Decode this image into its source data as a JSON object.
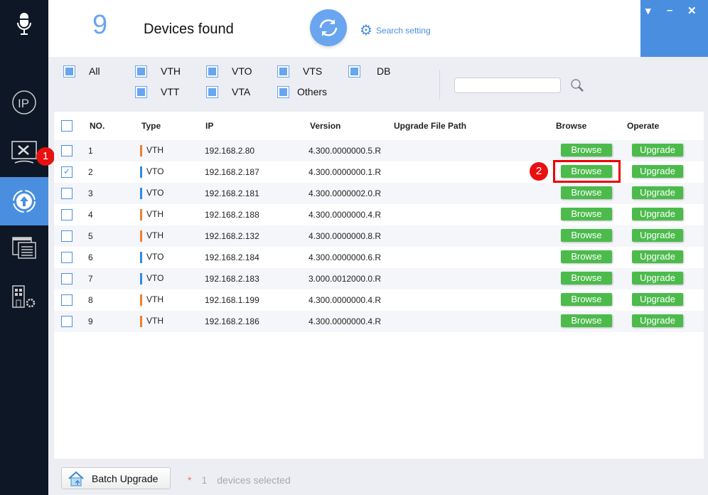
{
  "header": {
    "count": "9",
    "title": "Devices found",
    "search_setting": "Search setting"
  },
  "window": {
    "menu": "▾",
    "minimize": "–",
    "close": "✕"
  },
  "filters": [
    {
      "label": "All"
    },
    {
      "label": "VTH"
    },
    {
      "label": "VTO"
    },
    {
      "label": "VTS"
    },
    {
      "label": "DB"
    },
    {
      "label": "VTT"
    },
    {
      "label": "VTA"
    },
    {
      "label": "Others"
    }
  ],
  "search": {
    "value": "",
    "placeholder": ""
  },
  "table": {
    "columns": [
      "NO.",
      "Type",
      "IP",
      "Version",
      "Upgrade File Path",
      "Browse",
      "Operate"
    ],
    "browse_label": "Browse",
    "upgrade_label": "Upgrade",
    "rows": [
      {
        "no": "1",
        "type": "VTH",
        "ip": "192.168.2.80",
        "version": "4.300.0000000.5.R",
        "path": "",
        "checked": false
      },
      {
        "no": "2",
        "type": "VTO",
        "ip": "192.168.2.187",
        "version": "4.300.0000000.1.R",
        "path": "",
        "checked": true
      },
      {
        "no": "3",
        "type": "VTO",
        "ip": "192.168.2.181",
        "version": "4.300.0000002.0.R",
        "path": "",
        "checked": false
      },
      {
        "no": "4",
        "type": "VTH",
        "ip": "192.168.2.188",
        "version": "4.300.0000000.4.R",
        "path": "",
        "checked": false
      },
      {
        "no": "5",
        "type": "VTH",
        "ip": "192.168.2.132",
        "version": "4.300.0000000.8.R",
        "path": "",
        "checked": false
      },
      {
        "no": "6",
        "type": "VTO",
        "ip": "192.168.2.184",
        "version": "4.300.0000000.6.R",
        "path": "",
        "checked": false
      },
      {
        "no": "7",
        "type": "VTO",
        "ip": "192.168.2.183",
        "version": "3.000.0012000.0.R",
        "path": "",
        "checked": false
      },
      {
        "no": "8",
        "type": "VTH",
        "ip": "192.168.1.199",
        "version": "4.300.0000000.4.R",
        "path": "",
        "checked": false
      },
      {
        "no": "9",
        "type": "VTH",
        "ip": "192.168.2.186",
        "version": "4.300.0000000.4.R",
        "path": "",
        "checked": false
      }
    ]
  },
  "type_colors": {
    "VTH": "#f08030",
    "VTO": "#2f8ae8"
  },
  "annotations": {
    "step1": "1",
    "step2": "2"
  },
  "footer": {
    "batch_upgrade": "Batch Upgrade",
    "asterisk": "*",
    "selected_count": "1",
    "selected_text": "devices selected"
  }
}
